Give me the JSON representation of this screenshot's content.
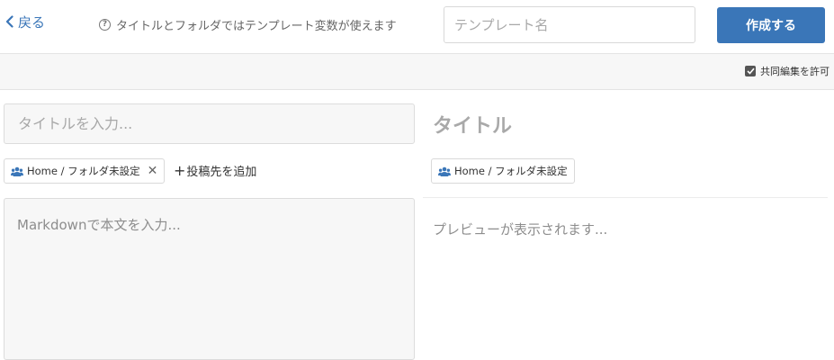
{
  "header": {
    "back_label": "戻る",
    "hint_text": "タイトルとフォルダではテンプレート変数が使えます",
    "template_name_placeholder": "テンプレート名",
    "template_name_value": "",
    "create_label": "作成する"
  },
  "toolbar": {
    "allow_collab_label": "共同編集を許可",
    "allow_collab_checked": true
  },
  "editor": {
    "title_placeholder": "タイトルを入力...",
    "folder_label": "Home / フォルダ未設定",
    "add_destination_label": "投稿先を追加",
    "body_placeholder": "Markdownで本文を入力..."
  },
  "preview": {
    "title": "タイトル",
    "folder_label": "Home / フォルダ未設定",
    "body_placeholder": "プレビューが表示されます..."
  },
  "colors": {
    "accent": "#3a76b8",
    "panel_bg": "#f7f7f7",
    "border": "#dcdcdc",
    "placeholder": "#a8a8a8"
  },
  "icons": {
    "back": "chevron-left-icon",
    "hint": "question-circle-icon",
    "checkbox": "check-icon",
    "folder_group": "users-icon",
    "remove": "close-icon"
  }
}
